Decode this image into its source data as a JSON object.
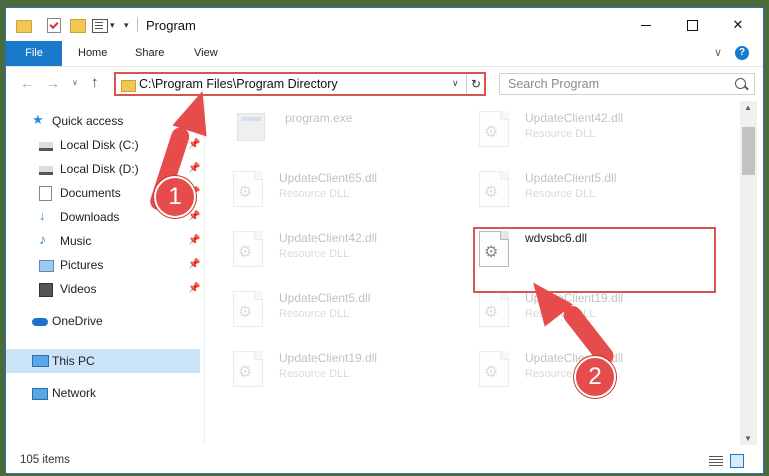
{
  "window": {
    "title": "Program",
    "controls": {
      "minimize": "",
      "maximize": "",
      "close": "✕"
    }
  },
  "ribbon": {
    "tabs": [
      "File",
      "Home",
      "Share",
      "View"
    ],
    "help": "?"
  },
  "navbar": {
    "address": "C:\\Program Files\\Program Directory",
    "search_placeholder": "Search Program"
  },
  "sidebar": {
    "items": [
      {
        "label": "Quick access",
        "icon": "star-icon",
        "pinned": false
      },
      {
        "label": "Local Disk (C:)",
        "icon": "drive-icon",
        "pinned": true
      },
      {
        "label": "Local Disk (D:)",
        "icon": "drive-icon",
        "pinned": true
      },
      {
        "label": "Documents",
        "icon": "documents-icon",
        "pinned": true
      },
      {
        "label": "Downloads",
        "icon": "downloads-icon",
        "pinned": true
      },
      {
        "label": "Music",
        "icon": "music-icon",
        "pinned": true
      },
      {
        "label": "Pictures",
        "icon": "pictures-icon",
        "pinned": true
      },
      {
        "label": "Videos",
        "icon": "videos-icon",
        "pinned": true
      },
      {
        "label": "OneDrive",
        "icon": "onedrive-icon",
        "pinned": false
      },
      {
        "label": "This PC",
        "icon": "this-pc-icon",
        "pinned": false,
        "selected": true
      },
      {
        "label": "Network",
        "icon": "network-icon",
        "pinned": false
      }
    ]
  },
  "files": [
    {
      "name": "program.exe",
      "type": "",
      "faded": true
    },
    {
      "name": "UpdateClient42.dll",
      "type": "Resource DLL",
      "faded": true
    },
    {
      "name": "UpdateClient65.dll",
      "type": "Resource DLL",
      "faded": true
    },
    {
      "name": "UpdateClient5.dll",
      "type": "Resource DLL",
      "faded": true
    },
    {
      "name": "UpdateClient42.dll",
      "type": "Resource DLL",
      "faded": true
    },
    {
      "name": "wdvsbc6.dll",
      "type": "",
      "faded": false,
      "highlighted": true
    },
    {
      "name": "UpdateClient5.dll",
      "type": "Resource DLL",
      "faded": true
    },
    {
      "name": "UpdateClient19.dll",
      "type": "Resource DLL",
      "faded": true
    },
    {
      "name": "UpdateClient19.dll",
      "type": "Resource DLL",
      "faded": true
    },
    {
      "name": "UpdateClient65.dll",
      "type": "Resource DLL",
      "faded": true
    }
  ],
  "status": {
    "items_count": "105 items"
  },
  "annotations": {
    "step1": "1",
    "step2": "2",
    "color": "#e74c4c"
  },
  "colors": {
    "accent": "#1979ca",
    "highlight": "#d9534f",
    "selected": "#cce4f7"
  }
}
